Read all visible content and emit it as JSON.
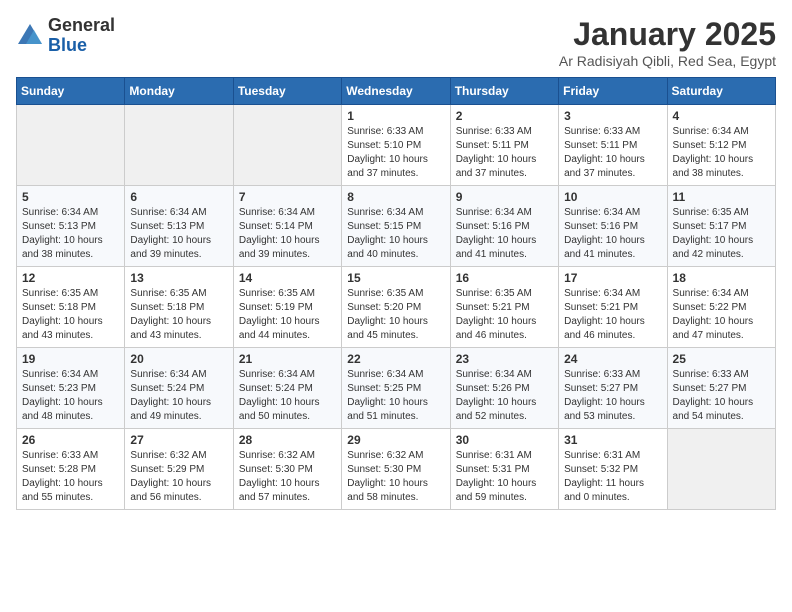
{
  "header": {
    "logo_general": "General",
    "logo_blue": "Blue",
    "month_title": "January 2025",
    "subtitle": "Ar Radisiyah Qibli, Red Sea, Egypt"
  },
  "days_of_week": [
    "Sunday",
    "Monday",
    "Tuesday",
    "Wednesday",
    "Thursday",
    "Friday",
    "Saturday"
  ],
  "weeks": [
    [
      {
        "day": "",
        "info": ""
      },
      {
        "day": "",
        "info": ""
      },
      {
        "day": "",
        "info": ""
      },
      {
        "day": "1",
        "info": "Sunrise: 6:33 AM\nSunset: 5:10 PM\nDaylight: 10 hours\nand 37 minutes."
      },
      {
        "day": "2",
        "info": "Sunrise: 6:33 AM\nSunset: 5:11 PM\nDaylight: 10 hours\nand 37 minutes."
      },
      {
        "day": "3",
        "info": "Sunrise: 6:33 AM\nSunset: 5:11 PM\nDaylight: 10 hours\nand 37 minutes."
      },
      {
        "day": "4",
        "info": "Sunrise: 6:34 AM\nSunset: 5:12 PM\nDaylight: 10 hours\nand 38 minutes."
      }
    ],
    [
      {
        "day": "5",
        "info": "Sunrise: 6:34 AM\nSunset: 5:13 PM\nDaylight: 10 hours\nand 38 minutes."
      },
      {
        "day": "6",
        "info": "Sunrise: 6:34 AM\nSunset: 5:13 PM\nDaylight: 10 hours\nand 39 minutes."
      },
      {
        "day": "7",
        "info": "Sunrise: 6:34 AM\nSunset: 5:14 PM\nDaylight: 10 hours\nand 39 minutes."
      },
      {
        "day": "8",
        "info": "Sunrise: 6:34 AM\nSunset: 5:15 PM\nDaylight: 10 hours\nand 40 minutes."
      },
      {
        "day": "9",
        "info": "Sunrise: 6:34 AM\nSunset: 5:16 PM\nDaylight: 10 hours\nand 41 minutes."
      },
      {
        "day": "10",
        "info": "Sunrise: 6:34 AM\nSunset: 5:16 PM\nDaylight: 10 hours\nand 41 minutes."
      },
      {
        "day": "11",
        "info": "Sunrise: 6:35 AM\nSunset: 5:17 PM\nDaylight: 10 hours\nand 42 minutes."
      }
    ],
    [
      {
        "day": "12",
        "info": "Sunrise: 6:35 AM\nSunset: 5:18 PM\nDaylight: 10 hours\nand 43 minutes."
      },
      {
        "day": "13",
        "info": "Sunrise: 6:35 AM\nSunset: 5:18 PM\nDaylight: 10 hours\nand 43 minutes."
      },
      {
        "day": "14",
        "info": "Sunrise: 6:35 AM\nSunset: 5:19 PM\nDaylight: 10 hours\nand 44 minutes."
      },
      {
        "day": "15",
        "info": "Sunrise: 6:35 AM\nSunset: 5:20 PM\nDaylight: 10 hours\nand 45 minutes."
      },
      {
        "day": "16",
        "info": "Sunrise: 6:35 AM\nSunset: 5:21 PM\nDaylight: 10 hours\nand 46 minutes."
      },
      {
        "day": "17",
        "info": "Sunrise: 6:34 AM\nSunset: 5:21 PM\nDaylight: 10 hours\nand 46 minutes."
      },
      {
        "day": "18",
        "info": "Sunrise: 6:34 AM\nSunset: 5:22 PM\nDaylight: 10 hours\nand 47 minutes."
      }
    ],
    [
      {
        "day": "19",
        "info": "Sunrise: 6:34 AM\nSunset: 5:23 PM\nDaylight: 10 hours\nand 48 minutes."
      },
      {
        "day": "20",
        "info": "Sunrise: 6:34 AM\nSunset: 5:24 PM\nDaylight: 10 hours\nand 49 minutes."
      },
      {
        "day": "21",
        "info": "Sunrise: 6:34 AM\nSunset: 5:24 PM\nDaylight: 10 hours\nand 50 minutes."
      },
      {
        "day": "22",
        "info": "Sunrise: 6:34 AM\nSunset: 5:25 PM\nDaylight: 10 hours\nand 51 minutes."
      },
      {
        "day": "23",
        "info": "Sunrise: 6:34 AM\nSunset: 5:26 PM\nDaylight: 10 hours\nand 52 minutes."
      },
      {
        "day": "24",
        "info": "Sunrise: 6:33 AM\nSunset: 5:27 PM\nDaylight: 10 hours\nand 53 minutes."
      },
      {
        "day": "25",
        "info": "Sunrise: 6:33 AM\nSunset: 5:27 PM\nDaylight: 10 hours\nand 54 minutes."
      }
    ],
    [
      {
        "day": "26",
        "info": "Sunrise: 6:33 AM\nSunset: 5:28 PM\nDaylight: 10 hours\nand 55 minutes."
      },
      {
        "day": "27",
        "info": "Sunrise: 6:32 AM\nSunset: 5:29 PM\nDaylight: 10 hours\nand 56 minutes."
      },
      {
        "day": "28",
        "info": "Sunrise: 6:32 AM\nSunset: 5:30 PM\nDaylight: 10 hours\nand 57 minutes."
      },
      {
        "day": "29",
        "info": "Sunrise: 6:32 AM\nSunset: 5:30 PM\nDaylight: 10 hours\nand 58 minutes."
      },
      {
        "day": "30",
        "info": "Sunrise: 6:31 AM\nSunset: 5:31 PM\nDaylight: 10 hours\nand 59 minutes."
      },
      {
        "day": "31",
        "info": "Sunrise: 6:31 AM\nSunset: 5:32 PM\nDaylight: 11 hours\nand 0 minutes."
      },
      {
        "day": "",
        "info": ""
      }
    ]
  ]
}
